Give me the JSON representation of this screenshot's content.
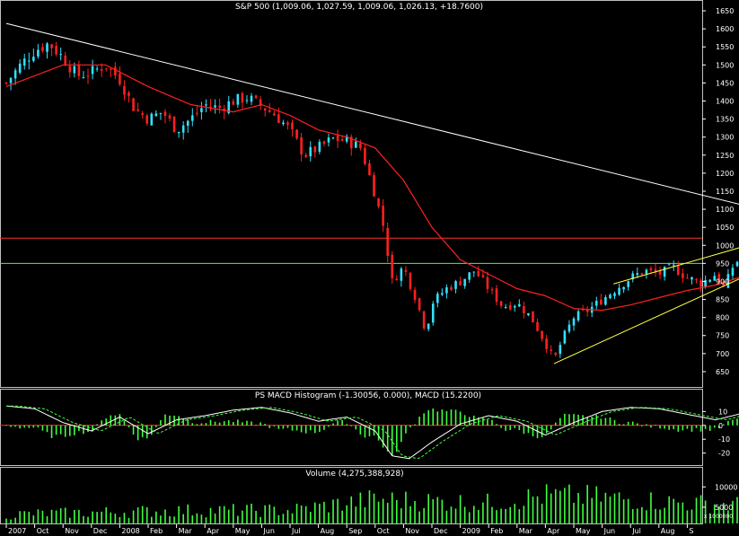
{
  "chart_data": [
    {
      "panel": "price",
      "type": "candlestick",
      "title": "S&P 500 (1,009.06, 1,027.59, 1,009.06, 1,026.13, +18.7600)",
      "ylim": [
        610,
        1670
      ],
      "yticks": [
        650,
        700,
        750,
        800,
        850,
        900,
        950,
        1000,
        1050,
        1100,
        1150,
        1200,
        1250,
        1300,
        1350,
        1400,
        1450,
        1500,
        1550,
        1600,
        1650
      ],
      "last_bar": {
        "open": 1009.06,
        "high": 1027.59,
        "low": 1009.06,
        "close": 1026.13,
        "change": 18.76
      },
      "close_path": [
        {
          "m": 0,
          "v": 1450
        },
        {
          "m": 0.5,
          "v": 1500
        },
        {
          "m": 1.0,
          "v": 1540
        },
        {
          "m": 1.5,
          "v": 1560
        },
        {
          "m": 2.0,
          "v": 1520
        },
        {
          "m": 2.5,
          "v": 1470
        },
        {
          "m": 3.0,
          "v": 1480
        },
        {
          "m": 3.5,
          "v": 1500
        },
        {
          "m": 4.0,
          "v": 1460
        },
        {
          "m": 4.5,
          "v": 1380
        },
        {
          "m": 5.0,
          "v": 1350
        },
        {
          "m": 5.5,
          "v": 1370
        },
        {
          "m": 6.0,
          "v": 1320
        },
        {
          "m": 6.5,
          "v": 1350
        },
        {
          "m": 7.0,
          "v": 1390
        },
        {
          "m": 7.5,
          "v": 1380
        },
        {
          "m": 8.0,
          "v": 1400
        },
        {
          "m": 8.5,
          "v": 1410
        },
        {
          "m": 9.0,
          "v": 1385
        },
        {
          "m": 9.5,
          "v": 1360
        },
        {
          "m": 10.0,
          "v": 1320
        },
        {
          "m": 10.5,
          "v": 1250
        },
        {
          "m": 11.0,
          "v": 1270
        },
        {
          "m": 11.5,
          "v": 1295
        },
        {
          "m": 12.0,
          "v": 1290
        },
        {
          "m": 12.5,
          "v": 1270
        },
        {
          "m": 13.0,
          "v": 1140
        },
        {
          "m": 13.3,
          "v": 1050
        },
        {
          "m": 13.6,
          "v": 900
        },
        {
          "m": 14.0,
          "v": 940
        },
        {
          "m": 14.4,
          "v": 860
        },
        {
          "m": 14.8,
          "v": 760
        },
        {
          "m": 15.0,
          "v": 840
        },
        {
          "m": 15.5,
          "v": 880
        },
        {
          "m": 16.0,
          "v": 900
        },
        {
          "m": 16.5,
          "v": 930
        },
        {
          "m": 17.0,
          "v": 880
        },
        {
          "m": 17.5,
          "v": 830
        },
        {
          "m": 18.0,
          "v": 840
        },
        {
          "m": 18.5,
          "v": 800
        },
        {
          "m": 19.0,
          "v": 730
        },
        {
          "m": 19.3,
          "v": 680
        },
        {
          "m": 19.6,
          "v": 740
        },
        {
          "m": 20.0,
          "v": 800
        },
        {
          "m": 20.5,
          "v": 820
        },
        {
          "m": 21.0,
          "v": 850
        },
        {
          "m": 21.5,
          "v": 880
        },
        {
          "m": 22.0,
          "v": 910
        },
        {
          "m": 22.5,
          "v": 930
        },
        {
          "m": 23.0,
          "v": 920
        },
        {
          "m": 23.5,
          "v": 940
        },
        {
          "m": 24.0,
          "v": 910
        },
        {
          "m": 24.5,
          "v": 895
        },
        {
          "m": 25.0,
          "v": 920
        },
        {
          "m": 25.3,
          "v": 880
        },
        {
          "m": 25.6,
          "v": 940
        },
        {
          "m": 26.0,
          "v": 980
        },
        {
          "m": 26.5,
          "v": 1000
        },
        {
          "m": 27.0,
          "v": 1010
        },
        {
          "m": 27.3,
          "v": 985
        },
        {
          "m": 27.7,
          "v": 1026
        }
      ],
      "moving_average": [
        {
          "m": 0,
          "v": 1440
        },
        {
          "m": 2,
          "v": 1500
        },
        {
          "m": 3.5,
          "v": 1500
        },
        {
          "m": 5,
          "v": 1440
        },
        {
          "m": 6.5,
          "v": 1390
        },
        {
          "m": 8,
          "v": 1370
        },
        {
          "m": 9,
          "v": 1390
        },
        {
          "m": 10,
          "v": 1360
        },
        {
          "m": 11,
          "v": 1320
        },
        {
          "m": 12,
          "v": 1300
        },
        {
          "m": 13,
          "v": 1270
        },
        {
          "m": 14,
          "v": 1180
        },
        {
          "m": 15,
          "v": 1050
        },
        {
          "m": 16,
          "v": 960
        },
        {
          "m": 17,
          "v": 920
        },
        {
          "m": 18,
          "v": 880
        },
        {
          "m": 19,
          "v": 860
        },
        {
          "m": 20,
          "v": 825
        },
        {
          "m": 21,
          "v": 820
        },
        {
          "m": 22,
          "v": 835
        },
        {
          "m": 23,
          "v": 855
        },
        {
          "m": 24,
          "v": 875
        },
        {
          "m": 25,
          "v": 890
        },
        {
          "m": 26,
          "v": 915
        },
        {
          "m": 27,
          "v": 945
        },
        {
          "m": 27.7,
          "v": 965
        }
      ],
      "horizontal_lines": [
        {
          "value": 1020,
          "color": "#ff3030"
        },
        {
          "value": 950,
          "color": "#40ff40"
        }
      ],
      "trend_lines": [
        {
          "from": {
            "m": 0,
            "v": 1615
          },
          "to": {
            "m": 28.1,
            "v": 1070
          },
          "color": "#ffffff"
        },
        {
          "from": {
            "m": 21.4,
            "v": 893
          },
          "to": {
            "m": 27.9,
            "v": 1040
          },
          "color": "#ffff40"
        },
        {
          "from": {
            "m": 19.3,
            "v": 672
          },
          "to": {
            "m": 28.0,
            "v": 985
          },
          "color": "#ffff40"
        }
      ],
      "colors": {
        "up": "#33e0ff",
        "down": "#ff2020",
        "ma": "#ff2020",
        "axis": "#ffffff"
      }
    },
    {
      "panel": "macd",
      "type": "histogram",
      "title": "PS MACD Histogram (-1.30056, 0.000), MACD (15.2200)",
      "ylim": [
        -28,
        18
      ],
      "yticks": [
        10,
        0,
        -10,
        -20
      ],
      "zero_line_color": "#ff3030",
      "macd_path": [
        {
          "m": 0,
          "v": 14
        },
        {
          "m": 1,
          "v": 12
        },
        {
          "m": 2,
          "v": 2
        },
        {
          "m": 3,
          "v": -4
        },
        {
          "m": 4,
          "v": 6
        },
        {
          "m": 5,
          "v": -6
        },
        {
          "m": 6,
          "v": 4
        },
        {
          "m": 7,
          "v": 7
        },
        {
          "m": 8,
          "v": 11
        },
        {
          "m": 9,
          "v": 13
        },
        {
          "m": 10,
          "v": 9
        },
        {
          "m": 11,
          "v": 3
        },
        {
          "m": 12,
          "v": 6
        },
        {
          "m": 13,
          "v": -4
        },
        {
          "m": 13.6,
          "v": -22
        },
        {
          "m": 14.2,
          "v": -24
        },
        {
          "m": 15,
          "v": -12
        },
        {
          "m": 16,
          "v": 1
        },
        {
          "m": 17,
          "v": 7
        },
        {
          "m": 18,
          "v": 3
        },
        {
          "m": 19,
          "v": -7
        },
        {
          "m": 20,
          "v": 2
        },
        {
          "m": 21,
          "v": 10
        },
        {
          "m": 22,
          "v": 13
        },
        {
          "m": 23,
          "v": 12
        },
        {
          "m": 24,
          "v": 8
        },
        {
          "m": 25,
          "v": 4
        },
        {
          "m": 26,
          "v": 9
        },
        {
          "m": 27,
          "v": 15
        },
        {
          "m": 27.7,
          "v": 14
        }
      ],
      "colors": {
        "bars": "#40ff40",
        "line": "#ffffff"
      }
    },
    {
      "panel": "volume",
      "type": "bar",
      "title": "Volume (4,275,388,928)",
      "ylim": [
        1000,
        12500
      ],
      "yticks": [
        10000,
        5000
      ],
      "ytick_labels": [
        "10000",
        "5000"
      ],
      "unit_label": "x 1000000",
      "volume_level": [
        {
          "m": 0,
          "v": 3500
        },
        {
          "m": 6,
          "v": 4500
        },
        {
          "m": 10,
          "v": 4600
        },
        {
          "m": 13,
          "v": 7500
        },
        {
          "m": 15,
          "v": 7000
        },
        {
          "m": 17,
          "v": 6500
        },
        {
          "m": 19,
          "v": 8500
        },
        {
          "m": 21,
          "v": 8000
        },
        {
          "m": 24,
          "v": 6500
        },
        {
          "m": 27.7,
          "v": 5500
        }
      ],
      "colors": {
        "bars": "#40ff40"
      }
    }
  ],
  "x_axis": {
    "labels": [
      {
        "m": 0,
        "label": "2007"
      },
      {
        "m": 1,
        "label": "Oct"
      },
      {
        "m": 2,
        "label": "Nov"
      },
      {
        "m": 3,
        "label": "Dec"
      },
      {
        "m": 4,
        "label": "2008"
      },
      {
        "m": 5,
        "label": "Feb"
      },
      {
        "m": 6,
        "label": "Mar"
      },
      {
        "m": 7,
        "label": "Apr"
      },
      {
        "m": 8,
        "label": "May"
      },
      {
        "m": 9,
        "label": "Jun"
      },
      {
        "m": 10,
        "label": "Jul"
      },
      {
        "m": 11,
        "label": "Aug"
      },
      {
        "m": 12,
        "label": "Sep"
      },
      {
        "m": 13,
        "label": "Oct"
      },
      {
        "m": 14,
        "label": "Nov"
      },
      {
        "m": 15,
        "label": "Dec"
      },
      {
        "m": 16,
        "label": "2009"
      },
      {
        "m": 17,
        "label": "Feb"
      },
      {
        "m": 18,
        "label": "Mar"
      },
      {
        "m": 19,
        "label": "Apr"
      },
      {
        "m": 20,
        "label": "May"
      },
      {
        "m": 21,
        "label": "Jun"
      },
      {
        "m": 22,
        "label": "Jul"
      },
      {
        "m": 23,
        "label": "Aug"
      },
      {
        "m": 24,
        "label": "S"
      }
    ]
  }
}
